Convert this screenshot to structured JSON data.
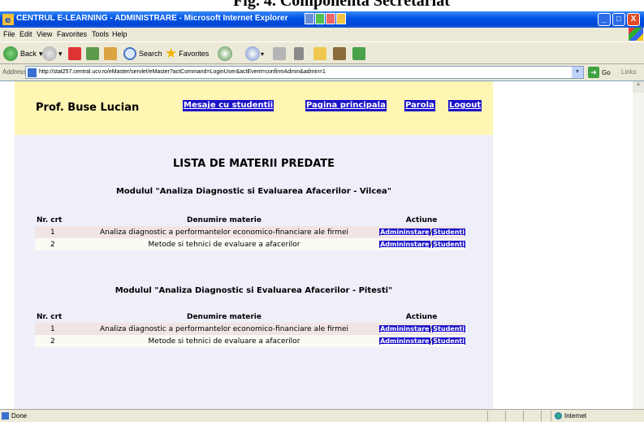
{
  "caption": "Fig. 4. Componenta Secretariat",
  "window": {
    "title": "CENTRUL E-LEARNING - ADMINISTRARE - Microsoft Internet Explorer",
    "minimize": "_",
    "maximize": "□",
    "close": "X"
  },
  "menu": [
    "File",
    "Edit",
    "View",
    "Favorites",
    "Tools",
    "Help"
  ],
  "toolbar": {
    "back": "Back",
    "search": "Search",
    "favorites": "Favorites"
  },
  "address": {
    "label": "Address",
    "url": "http://stat257.central.ucv.ro/eMaster/servlet/eMaster?actCommand=LoginUser&actEvent=confirmAdmin&admin=1",
    "go": "Go",
    "links": "Links"
  },
  "page": {
    "user": "Prof. Buse Lucian",
    "nav": {
      "messages": "Mesaje cu studentii",
      "home": "Pagina principala",
      "password": "Parola",
      "logout": "Logout"
    },
    "heading": "LISTA DE MATERII PREDATE",
    "columns": {
      "nr": "Nr. crt",
      "name": "Denumire materie",
      "actions": "Actiune"
    },
    "action_labels": {
      "admin": "Admininstare",
      "students": "Studenti",
      "separator": "/"
    },
    "modules": [
      {
        "title": "Modulul \"Analiza Diagnostic si Evaluarea Afacerilor - Vilcea\"",
        "rows": [
          {
            "nr": "1",
            "name": "Analiza diagnostic a performantelor economico-financiare ale firmei"
          },
          {
            "nr": "2",
            "name": "Metode si tehnici de evaluare a afacerilor"
          }
        ]
      },
      {
        "title": "Modulul \"Analiza Diagnostic si Evaluarea Afacerilor - Pitesti\"",
        "rows": [
          {
            "nr": "1",
            "name": "Analiza diagnostic a performantelor economico-financiare ale firmei"
          },
          {
            "nr": "2",
            "name": "Metode si tehnici de evaluare a afacerilor"
          }
        ]
      }
    ]
  },
  "status": {
    "left": "Done",
    "zone": "Internet"
  }
}
